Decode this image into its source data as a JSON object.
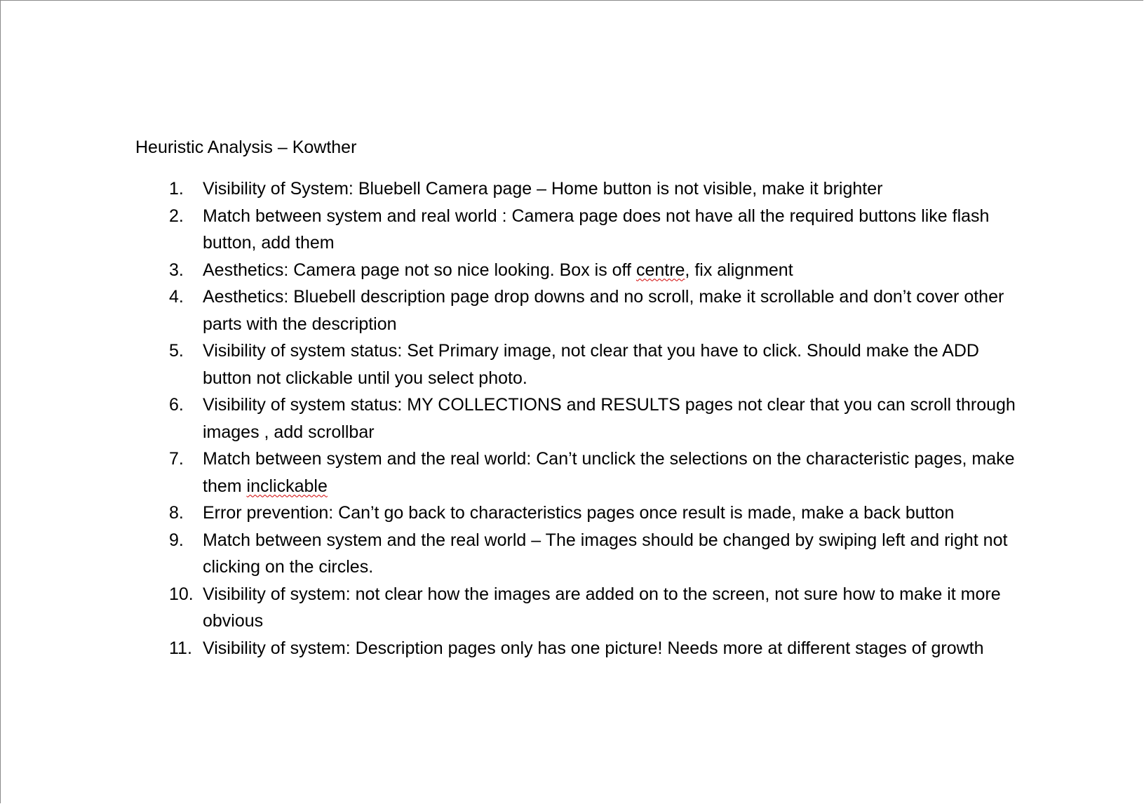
{
  "document": {
    "title": "Heuristic Analysis – Kowther",
    "items": [
      {
        "number": "1.",
        "text": "Visibility of System: Bluebell Camera page – Home button is not visible, make it brighter"
      },
      {
        "number": "2.",
        "text": "Match between system and real world : Camera page does not have all the required buttons like flash button, add them"
      },
      {
        "number": "3.",
        "text_before": "Aesthetics: Camera page not so nice looking. Box is off ",
        "misspelled": "centre",
        "text_after": ", fix alignment"
      },
      {
        "number": "4.",
        "text": "Aesthetics: Bluebell description page drop downs and no scroll, make it scrollable and don’t cover other parts with the description"
      },
      {
        "number": "5.",
        "text": "Visibility of system status: Set Primary image, not clear that you have to click. Should make the ADD button not clickable until you select photo."
      },
      {
        "number": "6.",
        "text": "Visibility of system status: MY COLLECTIONS and RESULTS pages not clear that you can scroll through images , add scrollbar"
      },
      {
        "number": "7.",
        "text_before": "Match between system and the real world: Can’t unclick the selections on the characteristic pages, make them ",
        "misspelled": "inclickable",
        "text_after": ""
      },
      {
        "number": "8.",
        "text": "Error prevention: Can’t go back to characteristics pages once result is made, make a back button"
      },
      {
        "number": "9.",
        "text": "Match between system and the real world – The images should be changed by swiping left and right not clicking on the circles."
      },
      {
        "number": "10.",
        "text": "Visibility of system: not clear how the images are added on to the screen, not sure how to make it more obvious"
      },
      {
        "number": "11.",
        "text": "Visibility of system: Description pages only has one picture! Needs more at different stages of growth"
      }
    ],
    "spellcheck_underline_color": "#d00000"
  }
}
